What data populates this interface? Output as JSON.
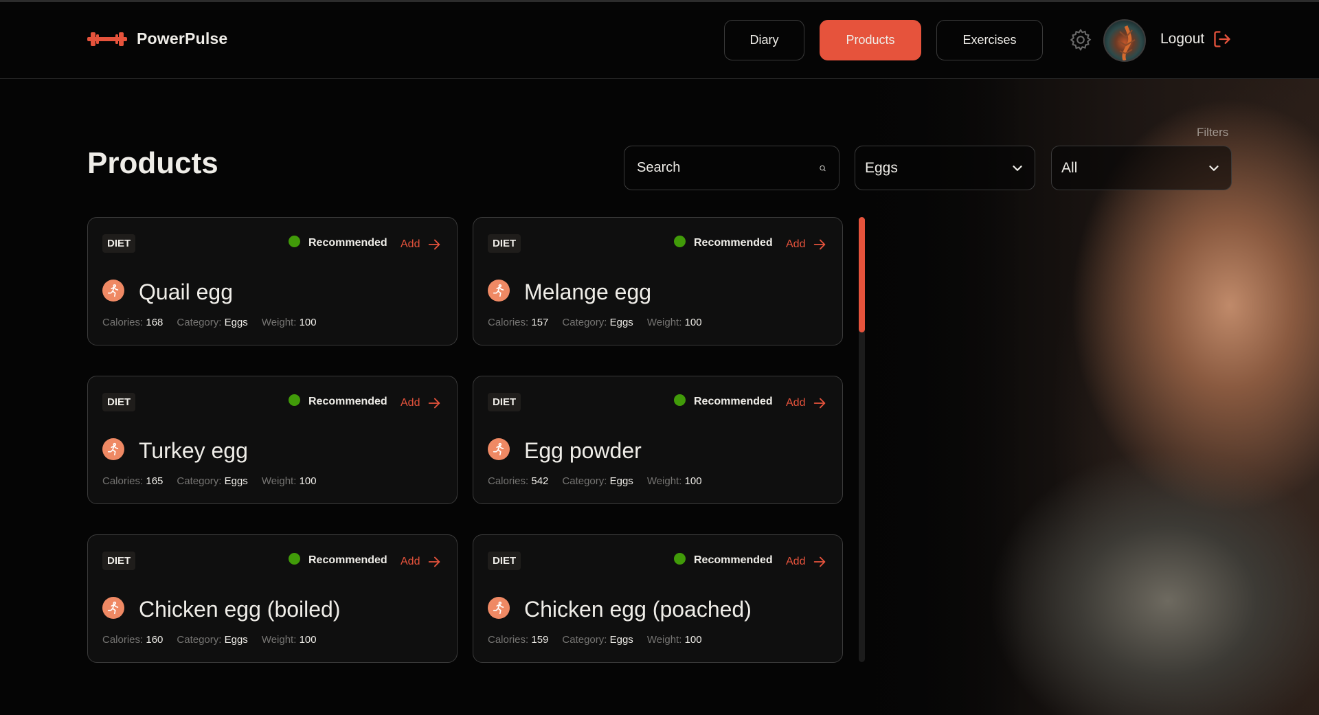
{
  "app": {
    "name": "PowerPulse"
  },
  "nav": {
    "diary_label": "Diary",
    "products_label": "Products",
    "exercises_label": "Exercises",
    "logout_label": "Logout"
  },
  "page": {
    "title": "Products",
    "filters_label": "Filters",
    "search_placeholder": "Search",
    "category_selected": "Eggs",
    "recommendation_selected": "All"
  },
  "products": [
    {
      "badge": "DIET",
      "status": "Recommended",
      "add_label": "Add",
      "name": "Quail egg",
      "calories_key": "Calories:",
      "calories": "168",
      "category_key": "Category:",
      "category": "Eggs",
      "weight_key": "Weight:",
      "weight": "100"
    },
    {
      "badge": "DIET",
      "status": "Recommended",
      "add_label": "Add",
      "name": "Melange egg",
      "calories_key": "Calories:",
      "calories": "157",
      "category_key": "Category:",
      "category": "Eggs",
      "weight_key": "Weight:",
      "weight": "100"
    },
    {
      "badge": "DIET",
      "status": "Recommended",
      "add_label": "Add",
      "name": "Turkey egg",
      "calories_key": "Calories:",
      "calories": "165",
      "category_key": "Category:",
      "category": "Eggs",
      "weight_key": "Weight:",
      "weight": "100"
    },
    {
      "badge": "DIET",
      "status": "Recommended",
      "add_label": "Add",
      "name": "Egg powder",
      "calories_key": "Calories:",
      "calories": "542",
      "category_key": "Category:",
      "category": "Eggs",
      "weight_key": "Weight:",
      "weight": "100"
    },
    {
      "badge": "DIET",
      "status": "Recommended",
      "add_label": "Add",
      "name": "Chicken egg (boiled)",
      "calories_key": "Calories:",
      "calories": "160",
      "category_key": "Category:",
      "category": "Eggs",
      "weight_key": "Weight:",
      "weight": "100"
    },
    {
      "badge": "DIET",
      "status": "Recommended",
      "add_label": "Add",
      "name": "Chicken egg (poached)",
      "calories_key": "Calories:",
      "calories": "159",
      "category_key": "Category:",
      "category": "Eggs",
      "weight_key": "Weight:",
      "weight": "100"
    }
  ],
  "colors": {
    "accent": "#E6533C",
    "recommended": "#419B09",
    "runner": "#EF8964",
    "background": "#050505"
  },
  "icons": {
    "logo": "dumbbell-icon",
    "settings": "gear-icon",
    "logout": "logout-icon",
    "search": "search-icon",
    "dropdown": "chevron-down-icon",
    "add": "arrow-right-icon",
    "product": "running-man-icon"
  },
  "scroll": {
    "position_fraction": 0.0,
    "visible_fraction": 0.26
  }
}
